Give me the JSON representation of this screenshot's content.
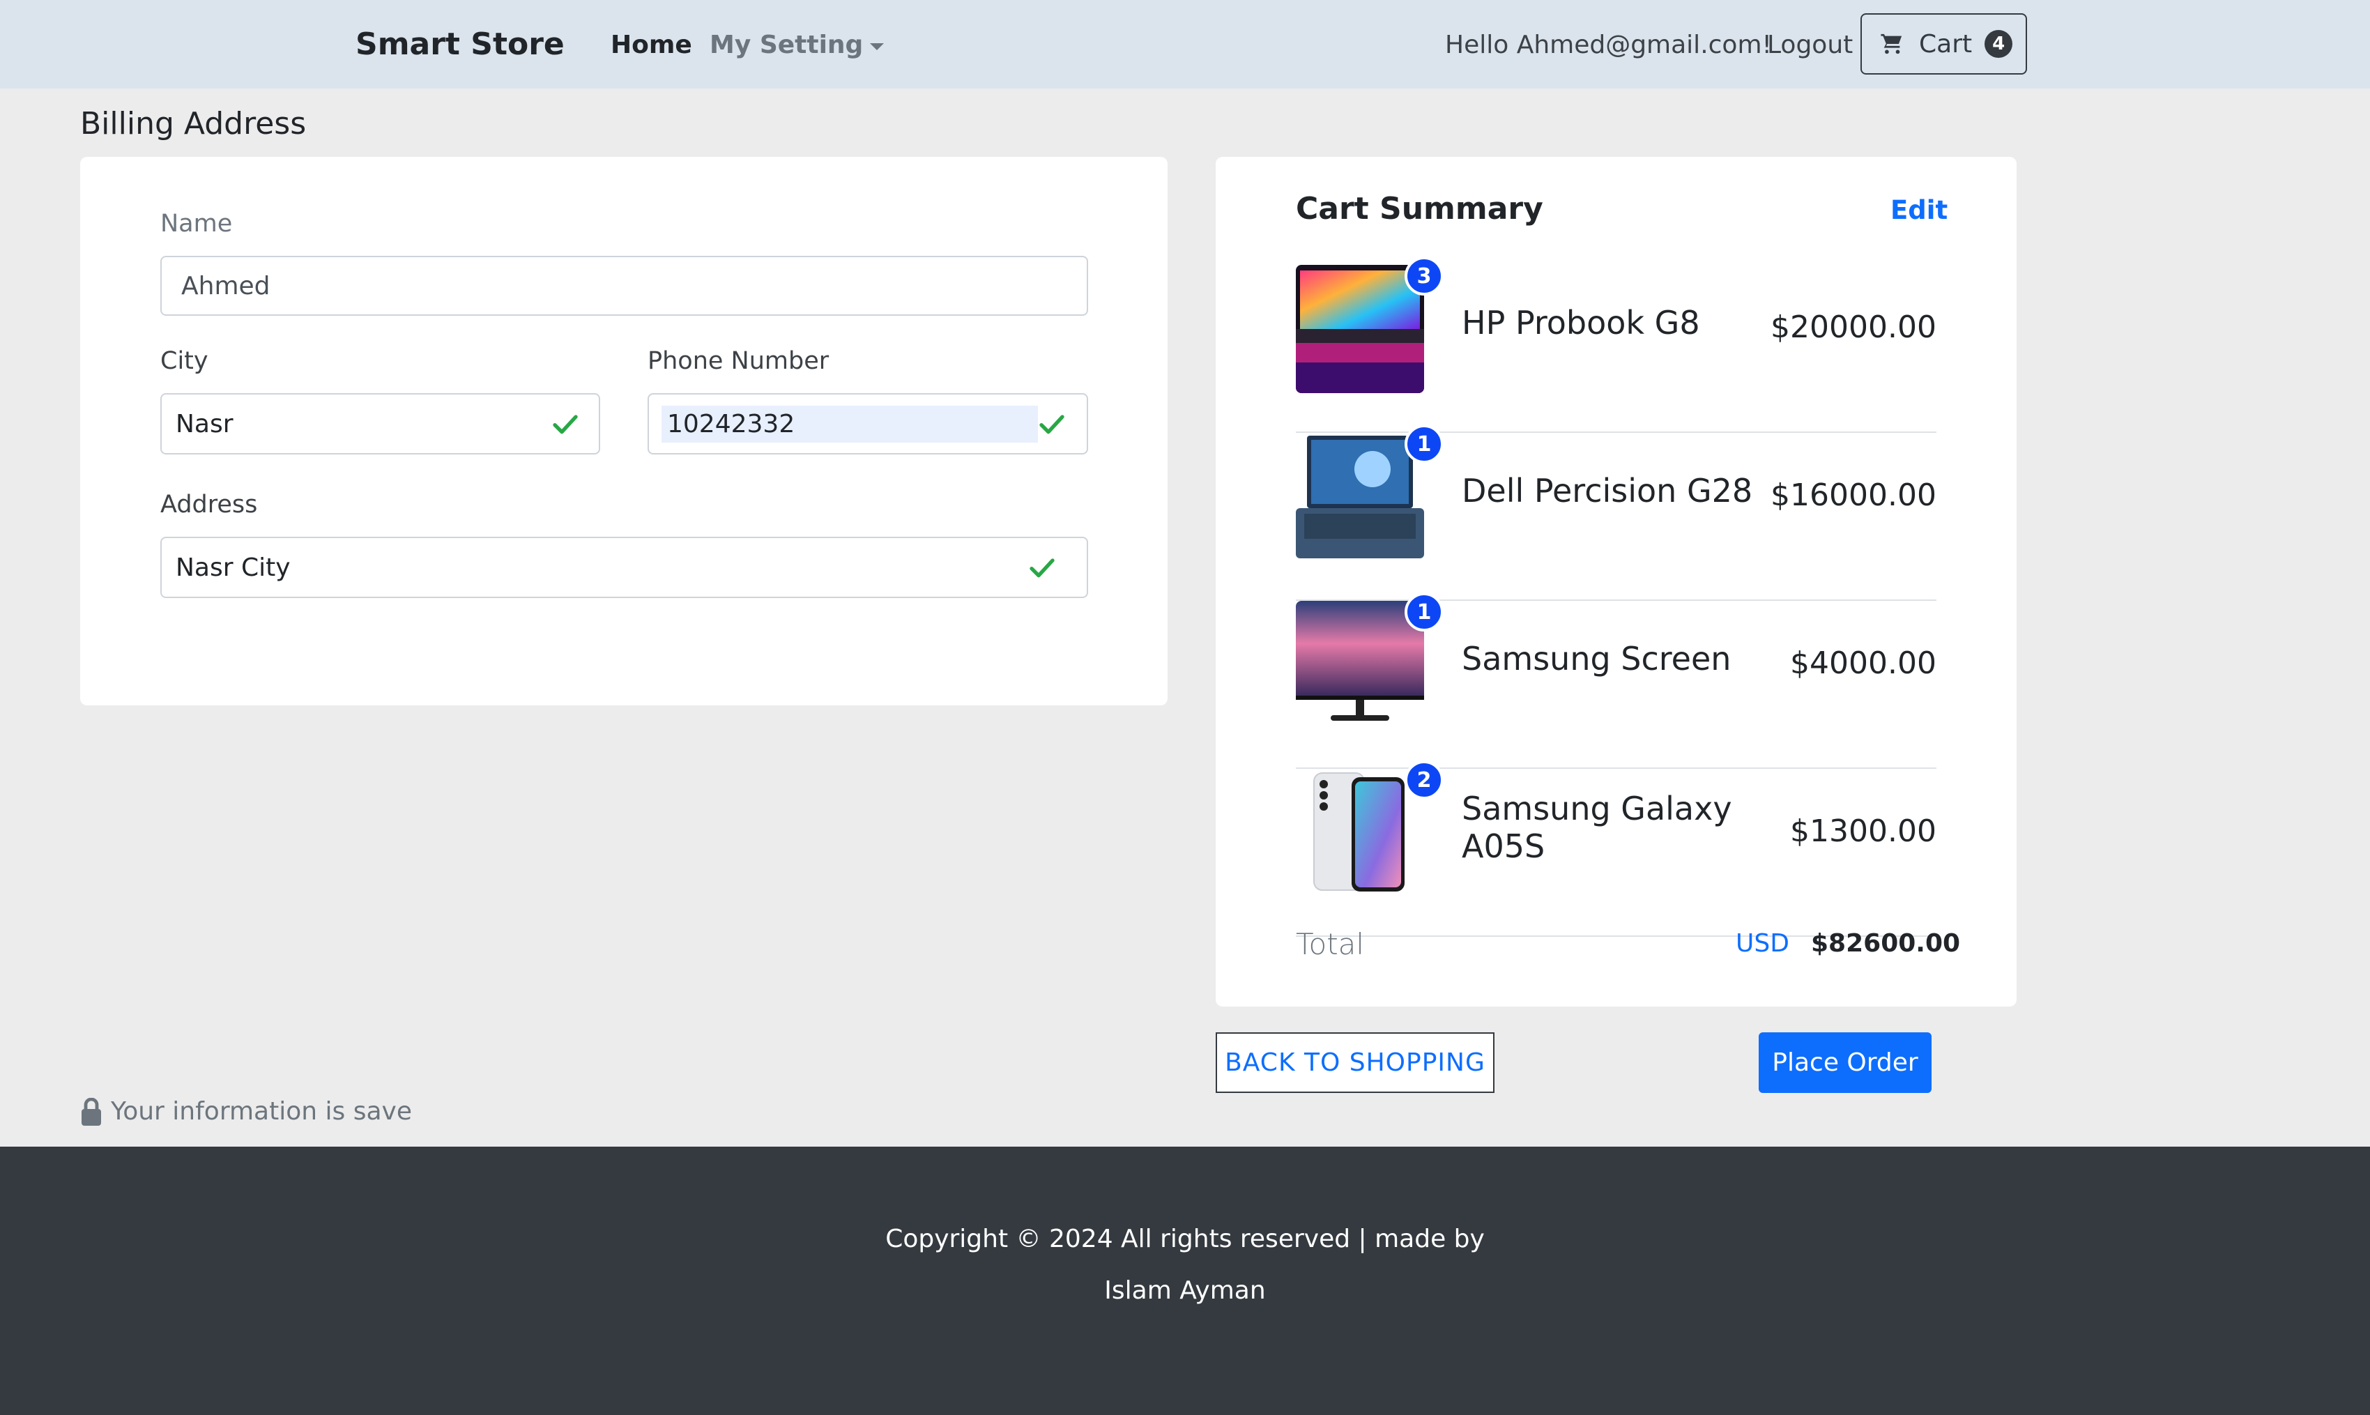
{
  "navbar": {
    "brand": "Smart Store",
    "home": "Home",
    "settings": "My Setting",
    "greeting": "Hello Ahmed@gmail.com!",
    "logout": "Logout",
    "cart_label": "Cart",
    "cart_count": "4"
  },
  "billing": {
    "title": "Billing Address",
    "name_label": "Name",
    "name_value": "Ahmed",
    "city_label": "City",
    "city_value": "Nasr",
    "phone_label": "Phone Number",
    "phone_value": "10242332",
    "address_label": "Address",
    "address_value": "Nasr City",
    "saved_note": "Your information is save"
  },
  "summary": {
    "title": "Cart Summary",
    "edit": "Edit",
    "items": [
      {
        "name": "HP Probook G8",
        "price": "$20000.00",
        "qty": "3"
      },
      {
        "name": "Dell Percision G28",
        "price": "$16000.00",
        "qty": "1"
      },
      {
        "name": "Samsung Screen",
        "price": "$4000.00",
        "qty": "1"
      },
      {
        "name": "Samsung Galaxy A05S",
        "price": "$1300.00",
        "qty": "2"
      }
    ],
    "total_label": "Total",
    "currency": "USD",
    "total": "$82600.00"
  },
  "actions": {
    "back": "BACK TO SHOPPING",
    "place_order": "Place Order"
  },
  "footer": {
    "line1": "Copyright © 2024 All rights reserved | made by",
    "line2": "Islam Ayman"
  },
  "colors": {
    "navbar_bg": "#dbe4ed",
    "page_bg": "#ececec",
    "primary": "#0d6efd",
    "badge": "#0d47f5",
    "valid": "#28a745",
    "footer_bg": "#343a40"
  }
}
